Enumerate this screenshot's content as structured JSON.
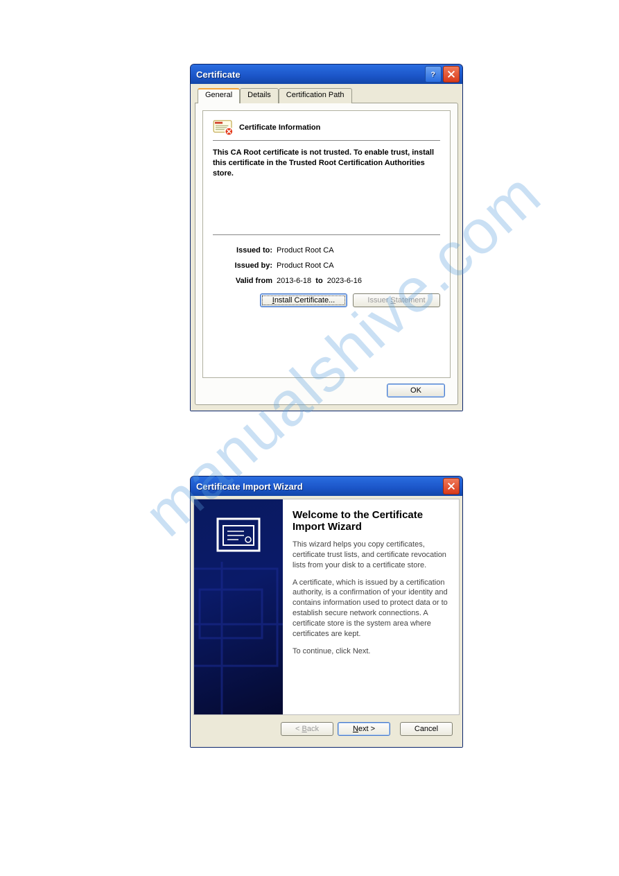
{
  "watermark": "manualshive.com",
  "dialog1": {
    "title": "Certificate",
    "tabs": {
      "t0": "General",
      "t1": "Details",
      "t2": "Certification Path"
    },
    "heading": "Certificate Information",
    "message": "This CA Root certificate is not trusted. To enable trust, install this certificate in the Trusted Root Certification Authorities store.",
    "rows": {
      "issued_to_label": "Issued to:",
      "issued_to_value": "Product Root CA",
      "issued_by_label": "Issued by:",
      "issued_by_value": "Product Root CA",
      "valid_label": "Valid from",
      "valid_from": "2013-6-18",
      "valid_to_word": "to",
      "valid_to": "2023-6-16"
    },
    "buttons": {
      "install_pre": "I",
      "install_rest": "nstall Certificate...",
      "issuer_pre": "Issuer ",
      "issuer_u": "S",
      "issuer_rest": "tatement",
      "ok": "OK"
    }
  },
  "dialog2": {
    "title": "Certificate Import Wizard",
    "heading": "Welcome to the Certificate Import Wizard",
    "p1": "This wizard helps you copy certificates, certificate trust lists, and certificate revocation lists from your disk to a certificate store.",
    "p2": "A certificate, which is issued by a certification authority, is a confirmation of your identity and contains information used to protect data or to establish secure network connections. A certificate store is the system area where certificates are kept.",
    "p3": "To continue, click Next.",
    "buttons": {
      "back_pre": "< ",
      "back_u": "B",
      "back_rest": "ack",
      "next_u": "N",
      "next_rest": "ext >",
      "cancel": "Cancel"
    }
  }
}
